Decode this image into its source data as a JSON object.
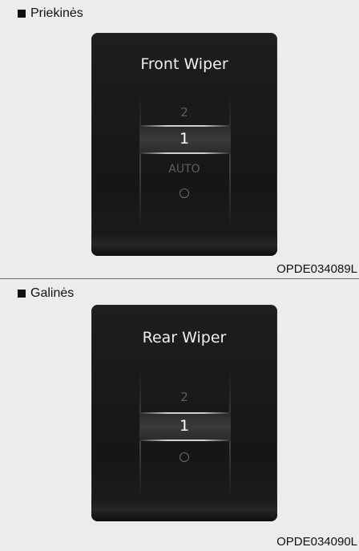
{
  "front": {
    "heading": "Priekinės",
    "panel_title": "Front Wiper",
    "options": {
      "high": "2",
      "selected": "1",
      "auto": "AUTO"
    },
    "off_icon": "circle-off-icon",
    "image_code": "OPDE034089L"
  },
  "rear": {
    "heading": "Galinės",
    "panel_title": "Rear Wiper",
    "options": {
      "high": "2",
      "selected": "1"
    },
    "off_icon": "circle-off-icon",
    "image_code": "OPDE034090L"
  },
  "colors": {
    "page_background": "#ececec",
    "panel_background": "#1a1a1a",
    "selected_text": "#ffffff",
    "dim_text": "#5e5e5e"
  }
}
